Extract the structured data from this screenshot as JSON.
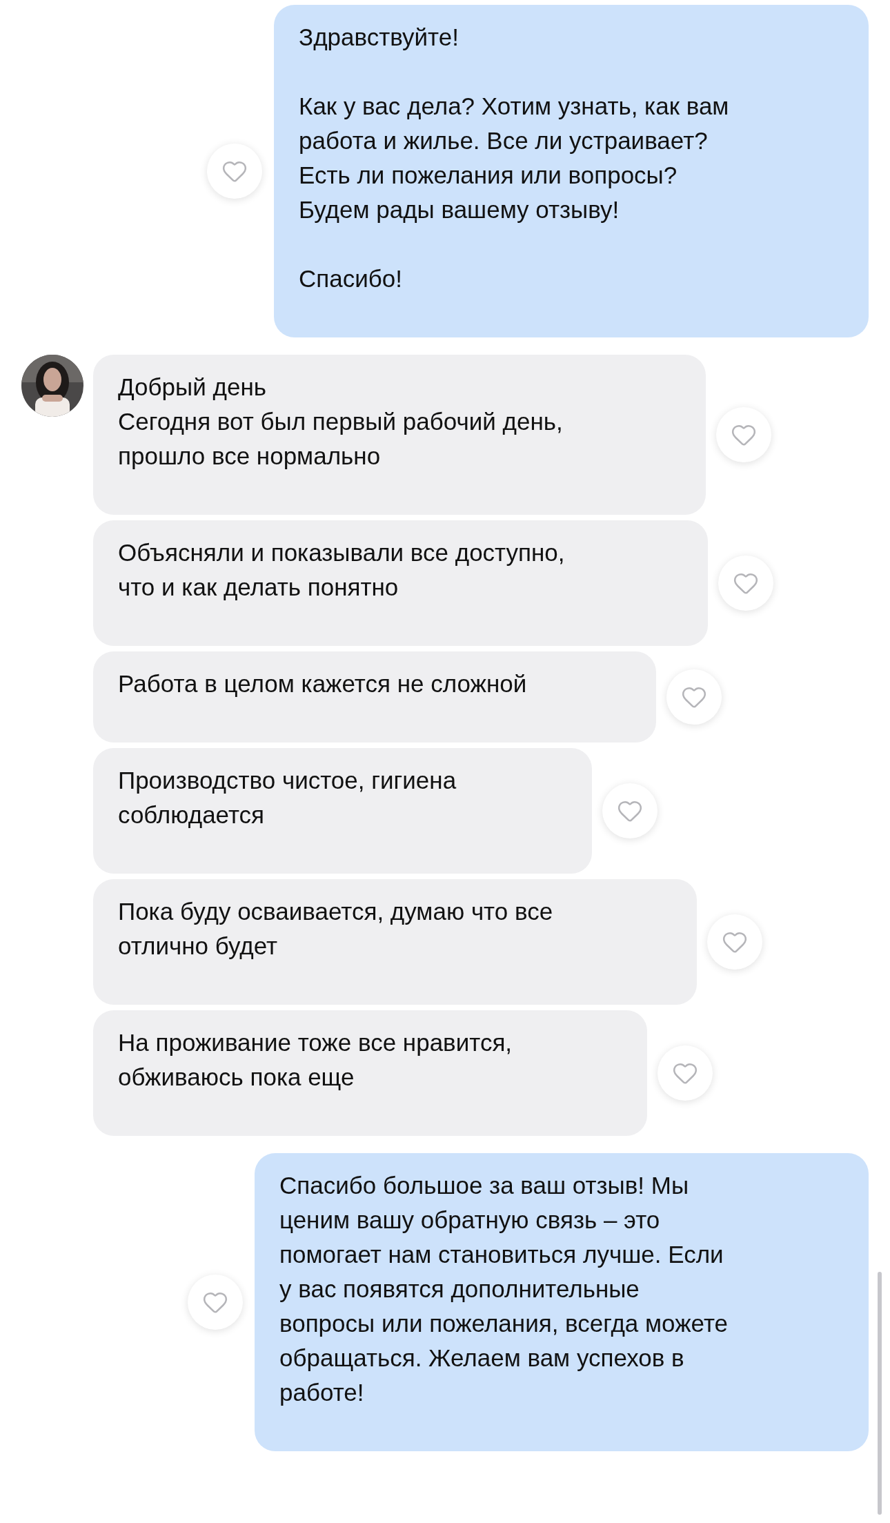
{
  "messages": [
    {
      "kind": "outgoing",
      "text": "Здравствуйте!\n\nКак у вас дела? Хотим узнать, как вам\nработа и жилье. Все ли устраивает?\nЕсть ли пожелания или вопросы?\nБудем рады вашему отзыву!\n\nСпасибо!"
    },
    {
      "kind": "incoming",
      "show_avatar": true,
      "text": "Добрый день\nСегодня вот был первый рабочий день,\nпрошло все нормально"
    },
    {
      "kind": "incoming",
      "show_avatar": false,
      "text": "Объясняли и показывали все доступно,\nчто и как делать понятно"
    },
    {
      "kind": "incoming",
      "show_avatar": false,
      "text": "Работа в целом кажется не сложной"
    },
    {
      "kind": "incoming",
      "show_avatar": false,
      "text": "Производство чистое, гигиена\nсоблюдается"
    },
    {
      "kind": "incoming",
      "show_avatar": false,
      "text": "Пока буду осваивается, думаю что все\nотлично будет"
    },
    {
      "kind": "incoming",
      "show_avatar": false,
      "text": "На проживание тоже все нравится,\nобживаюсь пока еще"
    },
    {
      "kind": "outgoing",
      "text": "Спасибо большое за ваш отзыв! Мы\nценим вашу обратную связь – это\nпомогает нам становиться лучше. Если\nу вас появятся дополнительные\nвопросы или пожелания, всегда можете\nобращаться. Желаем вам успехов в\nработе!"
    }
  ]
}
